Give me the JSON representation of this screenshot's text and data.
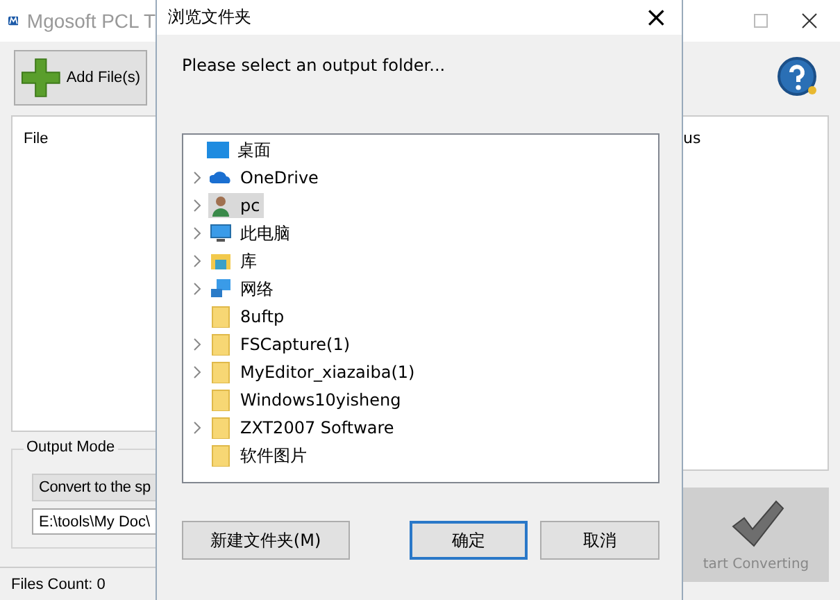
{
  "app_window": {
    "title": "Mgosoft PCL T",
    "add_button": "Add File(s)",
    "file_list": {
      "columns": [
        "File",
        "us"
      ]
    },
    "output_mode": {
      "label": "Output Mode",
      "mode_button": "Convert to the sp",
      "path": "E:\\tools\\My Doc\\"
    },
    "start_button": "tart Converting",
    "status_bar": "Files Count: 0"
  },
  "dialog": {
    "title": "浏览文件夹",
    "close": "×",
    "prompt": "Please select an output folder...",
    "tree": [
      {
        "label": "桌面",
        "kind": "desktop",
        "expandable": false,
        "selected": false,
        "children": [
          {
            "label": "OneDrive",
            "kind": "cloud",
            "expandable": true,
            "selected": false
          },
          {
            "label": "pc",
            "kind": "user",
            "expandable": true,
            "selected": true
          },
          {
            "label": "此电脑",
            "kind": "computer",
            "expandable": true,
            "selected": false
          },
          {
            "label": "库",
            "kind": "library",
            "expandable": true,
            "selected": false
          },
          {
            "label": "网络",
            "kind": "network",
            "expandable": true,
            "selected": false
          },
          {
            "label": "8uftp",
            "kind": "folder",
            "expandable": false,
            "selected": false
          },
          {
            "label": "FSCapture(1)",
            "kind": "folder",
            "expandable": true,
            "selected": false
          },
          {
            "label": "MyEditor_xiazaiba(1)",
            "kind": "folder",
            "expandable": true,
            "selected": false
          },
          {
            "label": "Windows10yisheng",
            "kind": "folder",
            "expandable": false,
            "selected": false
          },
          {
            "label": "ZXT2007 Software",
            "kind": "folder",
            "expandable": true,
            "selected": false
          },
          {
            "label": "软件图片",
            "kind": "folder",
            "expandable": false,
            "selected": false
          }
        ]
      }
    ],
    "buttons": [
      {
        "label": "新建文件夹(M)",
        "default": false
      },
      {
        "label": "确定",
        "default": true
      },
      {
        "label": "取消",
        "default": false
      }
    ]
  }
}
